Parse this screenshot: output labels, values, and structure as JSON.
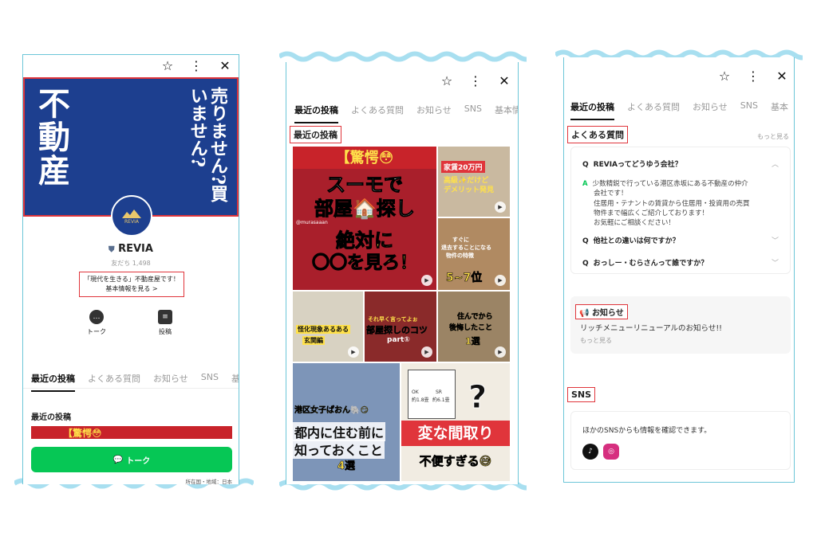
{
  "panel1": {
    "banner_left": "不動産",
    "banner_right": "売りません?買いません?",
    "logo_text": "REVIA",
    "name": "REVIA",
    "friends": "友だち 1,498",
    "desc_line1": "「現代を生きる」不動産屋です！",
    "desc_line2": "基本情報を見る >",
    "action_talk": "トーク",
    "action_post": "投稿",
    "tabs": [
      "最近の投稿",
      "よくある質問",
      "お知らせ",
      "SNS",
      "基本情"
    ],
    "section_title": "最近の投稿",
    "talk_button": "トーク",
    "footer": "所在国・地域：日本"
  },
  "panel2": {
    "tabs": [
      "最近の投稿",
      "よくある質問",
      "お知らせ",
      "SNS",
      "基本情"
    ],
    "section_title": "最近の投稿",
    "tiles": {
      "t1_top": "【驚愕😳",
      "t1_mid": "スーモで",
      "t1_mid2": "部屋🏠探し",
      "t1_bottom": "絶対に",
      "t1_bottom2": "〇〇を見ろ！",
      "t1_handle": "@murasaaan",
      "t2_cap1": "家賃20万円",
      "t2_cap2": "高級✨だけど",
      "t2_cap3": "デメリット発見",
      "t3_cap1": "すぐに",
      "t3_cap2": "退去することになる",
      "t3_cap3": "物件の特徴",
      "t3_rank": "5~7位",
      "t4_cap1": "怪化現象あるある",
      "t4_cap2": "玄関編",
      "t5_cap1": "それ早く言ってよぉ",
      "t5_cap2": "部屋探しのコツ",
      "t5_cap3": "part①",
      "t6_cap1": "住んでから",
      "t6_cap2": "後悔したこと",
      "t6_cap3": "1選",
      "t7_cap1": "港区女子ぱおん🐘😏",
      "t7_cap2": "都内に住む前に",
      "t7_cap3": "知っておくこと",
      "t7_cap4": "4選",
      "t8_q": "?",
      "t8_cap1": "変な間取り",
      "t8_cap2": "不便すぎる😅",
      "t8_plan1": "SR",
      "t8_plan2": "OK",
      "t8_plan3": "約6.1畳",
      "t8_plan4": "約1.8畳"
    }
  },
  "panel3": {
    "tabs": [
      "最近の投稿",
      "よくある質問",
      "お知らせ",
      "SNS",
      "基本"
    ],
    "faq_title": "よくある質問",
    "more": "もっと見る",
    "q1": "REVIAってどうゆう会社？",
    "a1_line1": "少数精鋭で行っている港区赤坂にある不動産の仲介",
    "a1_line2": "会社です！",
    "a1_line3": "住居用・テナントの賃貸から住居用・投資用の売買",
    "a1_line4": "物件まで幅広くご紹介しております！",
    "a1_line5": "お気軽にご相談ください！",
    "q2": "他社との違いは何ですか？",
    "q3": "おっしー・むらさんって誰ですか？",
    "news_title": "お知らせ",
    "news_text": "リッチメニューリニューアルのお知らせ!!",
    "news_more": "もっと見る",
    "sns_title": "SNS",
    "sns_text": "ほかのSNSからも情報を確認できます。",
    "q_mark": "Q",
    "a_mark": "A"
  },
  "colors": {
    "accent_red": "#e0353b",
    "line_green": "#06c755",
    "border_cyan": "#6cc6d8",
    "navy": "#1d3f8f"
  }
}
